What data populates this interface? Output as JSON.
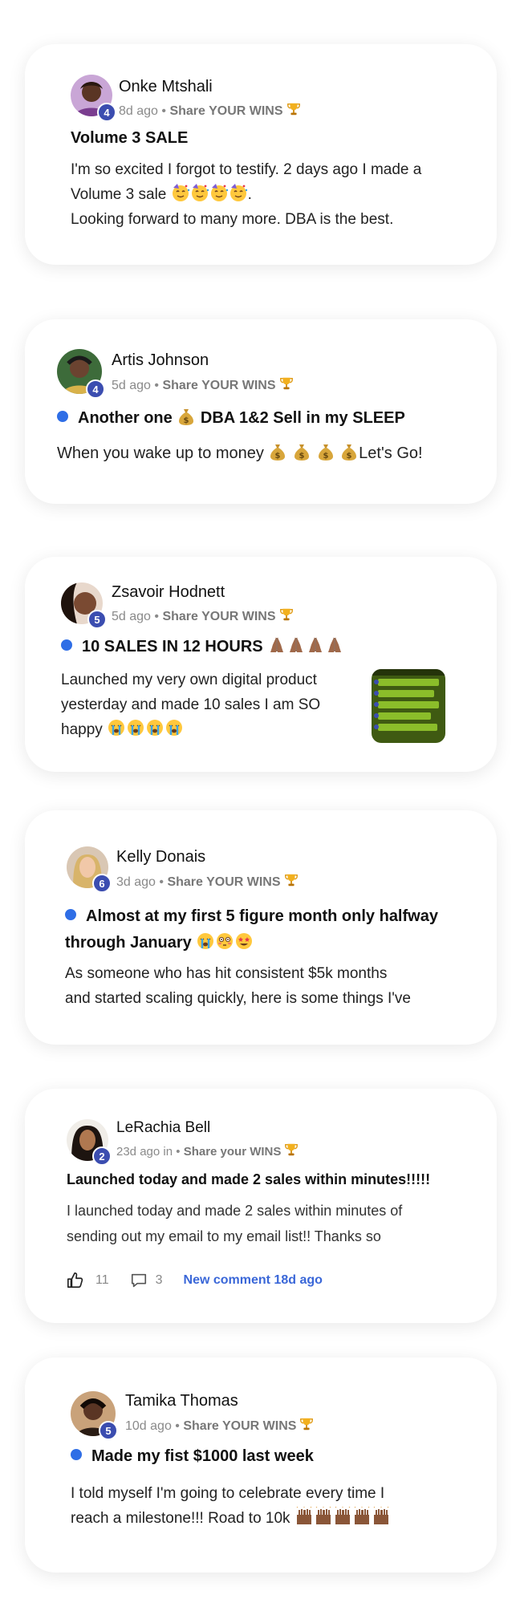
{
  "posts": [
    {
      "author": "Onke Mtshali",
      "level": "4",
      "time": "8d ago",
      "separator": "•",
      "category": "Share YOUR WINS",
      "title": "Volume 3 SALE",
      "body_lines": [
        "I'm so excited I forgot to testify. 2 days ago I made a",
        "Volume 3 sale",
        ".",
        "Looking forward to many more. DBA is the best."
      ]
    },
    {
      "author": "Artis Johnson",
      "level": "4",
      "time": "5d ago",
      "separator": "•",
      "category": "Share YOUR WINS",
      "title_a": "Another one",
      "title_b": "DBA 1&2 Sell in my SLEEP",
      "body_a": "When you wake up to money",
      "body_b": "Let's Go!"
    },
    {
      "author": "Zsavoir Hodnett",
      "level": "5",
      "time": "5d ago",
      "separator": "•",
      "category": "Share YOUR WINS",
      "title": "10 SALES IN 12 HOURS",
      "body_lines": [
        "Launched my very own digital product",
        "yesterday and made 10 sales I am SO",
        "happy"
      ]
    },
    {
      "author": "Kelly Donais",
      "level": "6",
      "time": "3d ago",
      "separator": "•",
      "category": "Share YOUR WINS",
      "title_lines": [
        "Almost at my first 5 figure month only halfway",
        "through January"
      ],
      "body_lines": [
        "As someone who has hit consistent $5k months",
        "and started scaling quickly, here is some things I've"
      ]
    },
    {
      "author": "LeRachia Bell",
      "level": "2",
      "time": "23d ago in",
      "separator": "•",
      "category": "Share your WINS",
      "title": "Launched today and made 2 sales within minutes!!!!!",
      "body_lines": [
        "I launched today and made 2 sales within minutes of",
        "sending out my email to my email list!! Thanks so"
      ],
      "likes": "11",
      "comments": "3",
      "new_comment": "New comment 18d ago"
    },
    {
      "author": "Tamika Thomas",
      "level": "5",
      "time": "10d ago",
      "separator": "•",
      "category": "Share YOUR WINS",
      "title": "Made my fist $1000 last week",
      "body_lines": [
        "I told myself I'm going to celebrate every time I",
        "reach a milestone!!! Road to 10k"
      ]
    }
  ],
  "icons": [
    "trophy-icon",
    "party-face-emoji",
    "money-bag-emoji",
    "praying-hands-emoji",
    "crying-face-emoji",
    "flushed-face-emoji",
    "star-struck-emoji",
    "raising-hands-emoji",
    "thumbs-up-icon",
    "comment-icon"
  ],
  "colors": {
    "level_badge": "#3b4db0",
    "unread_dot": "#2f6ee6",
    "link": "#3a67d8",
    "meta": "#8a8a8a"
  }
}
